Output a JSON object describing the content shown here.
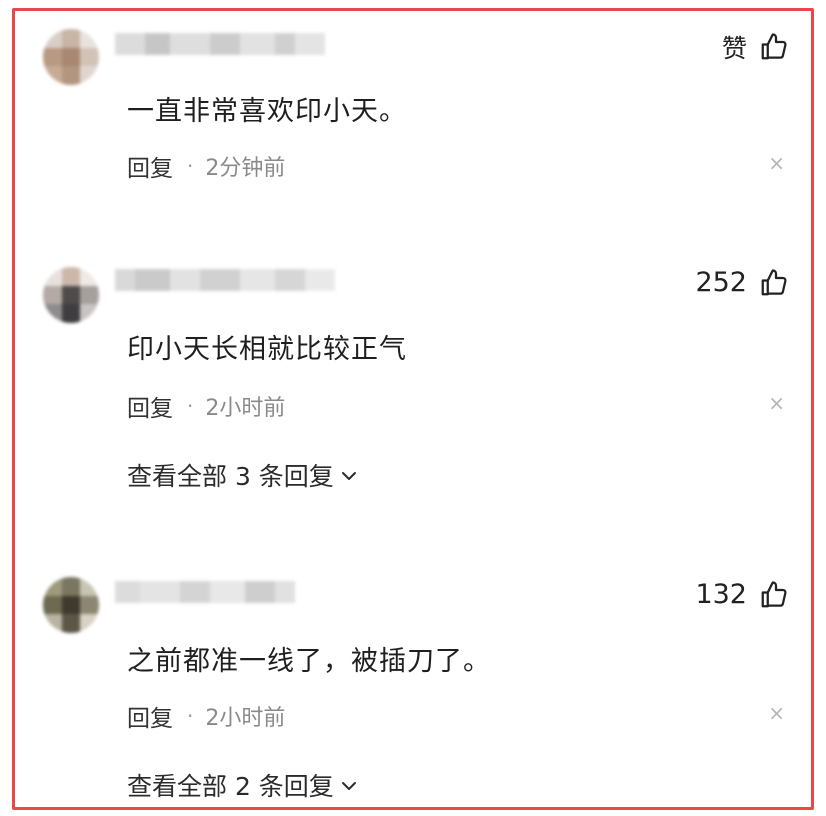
{
  "comments": [
    {
      "likes": "赞",
      "text": "一直非常喜欢印小天。",
      "reply_label": "回复",
      "time": "2分钟前",
      "close": "×"
    },
    {
      "likes": "252",
      "text": "印小天长相就比较正气",
      "reply_label": "回复",
      "time": "2小时前",
      "close": "×",
      "expand": "查看全部 3 条回复"
    },
    {
      "likes": "132",
      "text": "之前都准一线了，被插刀了。",
      "reply_label": "回复",
      "time": "2小时前",
      "close": "×",
      "expand": "查看全部 2 条回复"
    }
  ],
  "dot": "·",
  "colors": {
    "frame": "#e8474c",
    "meta": "#8a8a8a",
    "text": "#1f1f1f"
  },
  "icons": {
    "like": "thumbs-up-icon",
    "close": "close-icon",
    "expand": "chevron-down-icon"
  }
}
